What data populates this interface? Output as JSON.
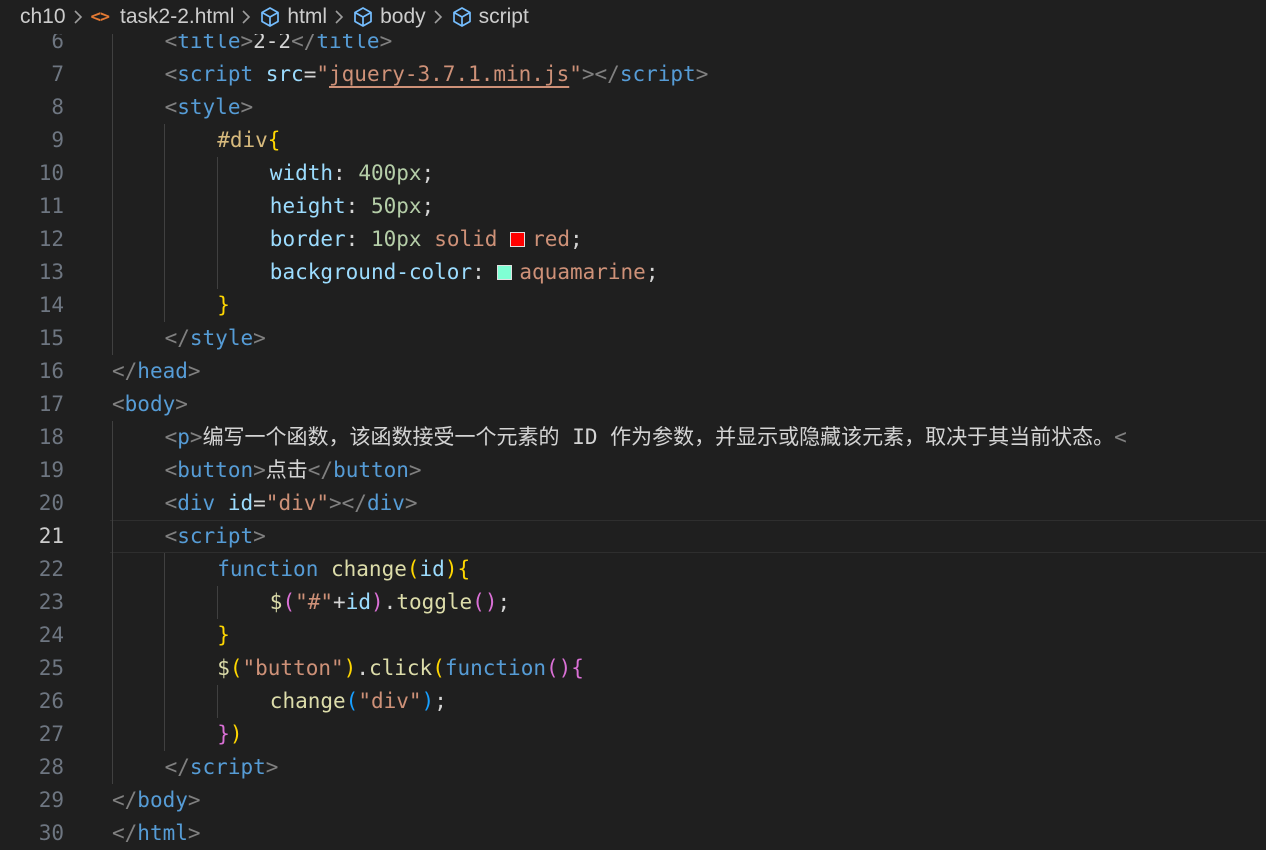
{
  "breadcrumb": {
    "items": [
      {
        "name": "breadcrumb-folder",
        "label": "ch10",
        "icon": ""
      },
      {
        "name": "breadcrumb-file",
        "label": "task2-2.html",
        "icon": "html-file-icon"
      },
      {
        "name": "breadcrumb-html",
        "label": "html",
        "icon": "symbol-element-icon"
      },
      {
        "name": "breadcrumb-body",
        "label": "body",
        "icon": "symbol-element-icon"
      },
      {
        "name": "breadcrumb-script",
        "label": "script",
        "icon": "symbol-element-icon"
      }
    ],
    "file_icon_glyph": "<>"
  },
  "colors": {
    "background": "#1f1f1f",
    "swatch_red": "#ff0000",
    "swatch_aquamarine": "#7fffd4"
  },
  "editor": {
    "current_line": 21,
    "lines": [
      {
        "n": "6",
        "indent": 2,
        "tokens": [
          [
            "punct",
            "<"
          ],
          [
            "tag",
            "title"
          ],
          [
            "punct",
            ">"
          ],
          [
            "text",
            "2-2"
          ],
          [
            "punct",
            "</"
          ],
          [
            "tag",
            "title"
          ],
          [
            "punct",
            ">"
          ]
        ]
      },
      {
        "n": "7",
        "indent": 2,
        "tokens": [
          [
            "punct",
            "<"
          ],
          [
            "tag",
            "script"
          ],
          [
            "text",
            " "
          ],
          [
            "attr",
            "src"
          ],
          [
            "text",
            "="
          ],
          [
            "str",
            "\""
          ],
          [
            "link",
            "jquery-3.7.1.min.js"
          ],
          [
            "str",
            "\""
          ],
          [
            "punct",
            "></"
          ],
          [
            "tag",
            "script"
          ],
          [
            "punct",
            ">"
          ]
        ]
      },
      {
        "n": "8",
        "indent": 2,
        "tokens": [
          [
            "punct",
            "<"
          ],
          [
            "tag",
            "style"
          ],
          [
            "punct",
            ">"
          ]
        ]
      },
      {
        "n": "9",
        "indent": 4,
        "tokens": [
          [
            "sel",
            "#div"
          ],
          [
            "b1",
            "{"
          ]
        ]
      },
      {
        "n": "10",
        "indent": 6,
        "tokens": [
          [
            "prop",
            "width"
          ],
          [
            "text",
            ": "
          ],
          [
            "num",
            "400px"
          ],
          [
            "text",
            ";"
          ]
        ]
      },
      {
        "n": "11",
        "indent": 6,
        "tokens": [
          [
            "prop",
            "height"
          ],
          [
            "text",
            ": "
          ],
          [
            "num",
            "50px"
          ],
          [
            "text",
            ";"
          ]
        ]
      },
      {
        "n": "12",
        "indent": 6,
        "tokens": [
          [
            "prop",
            "border"
          ],
          [
            "text",
            ": "
          ],
          [
            "num",
            "10px"
          ],
          [
            "text",
            " "
          ],
          [
            "val",
            "solid"
          ],
          [
            "text",
            " "
          ],
          [
            "swatch",
            "#ff0000"
          ],
          [
            "val",
            "red"
          ],
          [
            "text",
            ";"
          ]
        ]
      },
      {
        "n": "13",
        "indent": 6,
        "tokens": [
          [
            "prop",
            "background-color"
          ],
          [
            "text",
            ": "
          ],
          [
            "swatch",
            "#7fffd4"
          ],
          [
            "val",
            "aquamarine"
          ],
          [
            "text",
            ";"
          ]
        ]
      },
      {
        "n": "14",
        "indent": 4,
        "tokens": [
          [
            "b1",
            "}"
          ]
        ]
      },
      {
        "n": "15",
        "indent": 2,
        "tokens": [
          [
            "punct",
            "</"
          ],
          [
            "tag",
            "style"
          ],
          [
            "punct",
            ">"
          ]
        ]
      },
      {
        "n": "16",
        "indent": 0,
        "tokens": [
          [
            "punct",
            "</"
          ],
          [
            "tag",
            "head"
          ],
          [
            "punct",
            ">"
          ]
        ]
      },
      {
        "n": "17",
        "indent": 0,
        "tokens": [
          [
            "punct",
            "<"
          ],
          [
            "tag",
            "body"
          ],
          [
            "punct",
            ">"
          ]
        ]
      },
      {
        "n": "18",
        "indent": 2,
        "tokens": [
          [
            "punct",
            "<"
          ],
          [
            "tag",
            "p"
          ],
          [
            "punct",
            ">"
          ],
          [
            "text",
            "编写一个函数，该函数接受一个元素的 ID 作为参数，并显示或隐藏该元素，取决于其当前状态。"
          ],
          [
            "punct",
            "<"
          ]
        ]
      },
      {
        "n": "19",
        "indent": 2,
        "tokens": [
          [
            "punct",
            "<"
          ],
          [
            "tag",
            "button"
          ],
          [
            "punct",
            ">"
          ],
          [
            "text",
            "点击"
          ],
          [
            "punct",
            "</"
          ],
          [
            "tag",
            "button"
          ],
          [
            "punct",
            ">"
          ]
        ]
      },
      {
        "n": "20",
        "indent": 2,
        "tokens": [
          [
            "punct",
            "<"
          ],
          [
            "tag",
            "div"
          ],
          [
            "text",
            " "
          ],
          [
            "attr",
            "id"
          ],
          [
            "text",
            "="
          ],
          [
            "str",
            "\"div\""
          ],
          [
            "punct",
            "></"
          ],
          [
            "tag",
            "div"
          ],
          [
            "punct",
            ">"
          ]
        ]
      },
      {
        "n": "21",
        "indent": 2,
        "tokens": [
          [
            "punct",
            "<"
          ],
          [
            "tag",
            "script"
          ],
          [
            "punct",
            ">"
          ]
        ]
      },
      {
        "n": "22",
        "indent": 4,
        "tokens": [
          [
            "kw",
            "function"
          ],
          [
            "text",
            " "
          ],
          [
            "fn",
            "change"
          ],
          [
            "b1",
            "("
          ],
          [
            "var",
            "id"
          ],
          [
            "b1",
            ")"
          ],
          [
            "b1",
            "{"
          ]
        ]
      },
      {
        "n": "23",
        "indent": 6,
        "tokens": [
          [
            "fn",
            "$"
          ],
          [
            "b2",
            "("
          ],
          [
            "str",
            "\"#\""
          ],
          [
            "text",
            "+"
          ],
          [
            "var",
            "id"
          ],
          [
            "b2",
            ")"
          ],
          [
            "text",
            "."
          ],
          [
            "fn",
            "toggle"
          ],
          [
            "b2",
            "()"
          ],
          [
            "text",
            ";"
          ]
        ]
      },
      {
        "n": "24",
        "indent": 4,
        "tokens": [
          [
            "b1",
            "}"
          ]
        ]
      },
      {
        "n": "25",
        "indent": 4,
        "tokens": [
          [
            "fn",
            "$"
          ],
          [
            "b1",
            "("
          ],
          [
            "str",
            "\"button\""
          ],
          [
            "b1",
            ")"
          ],
          [
            "text",
            "."
          ],
          [
            "fn",
            "click"
          ],
          [
            "b1",
            "("
          ],
          [
            "kw",
            "function"
          ],
          [
            "b2",
            "()"
          ],
          [
            "b2",
            "{"
          ]
        ]
      },
      {
        "n": "26",
        "indent": 6,
        "tokens": [
          [
            "fn",
            "change"
          ],
          [
            "b3",
            "("
          ],
          [
            "str",
            "\"div\""
          ],
          [
            "b3",
            ")"
          ],
          [
            "text",
            ";"
          ]
        ]
      },
      {
        "n": "27",
        "indent": 4,
        "tokens": [
          [
            "b2",
            "}"
          ],
          [
            "b1",
            ")"
          ]
        ]
      },
      {
        "n": "28",
        "indent": 2,
        "tokens": [
          [
            "punct",
            "</"
          ],
          [
            "tag",
            "script"
          ],
          [
            "punct",
            ">"
          ]
        ]
      },
      {
        "n": "29",
        "indent": 0,
        "tokens": [
          [
            "punct",
            "</"
          ],
          [
            "tag",
            "body"
          ],
          [
            "punct",
            ">"
          ]
        ]
      },
      {
        "n": "30",
        "indent": 0,
        "tokens": [
          [
            "punct",
            "</"
          ],
          [
            "tag",
            "html"
          ],
          [
            "punct",
            ">"
          ]
        ]
      }
    ]
  }
}
